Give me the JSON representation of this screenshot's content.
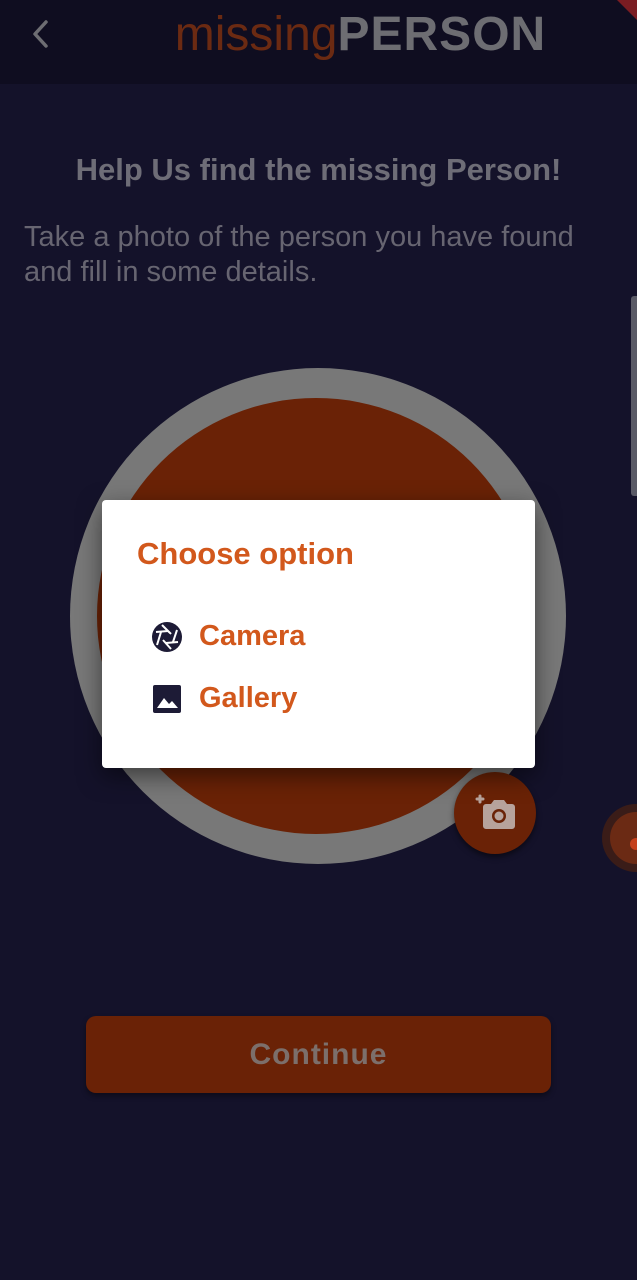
{
  "app_bar": {
    "title_part1": "missing",
    "title_part2": "PERSON",
    "back_icon": "chevron-left-icon"
  },
  "main": {
    "heading": "Help Us find the missing Person!",
    "description": "Take a photo of the person you have found and fill in some details.",
    "add_photo_icon": "add-a-photo-icon",
    "continue_label": "Continue"
  },
  "dialog": {
    "title": "Choose option",
    "options": [
      {
        "label": "Camera",
        "icon": "camera-shutter-icon"
      },
      {
        "label": "Gallery",
        "icon": "image-icon"
      }
    ]
  },
  "colors": {
    "background": "#14122a",
    "accent": "#d2581c",
    "accent_dark": "#6a2206",
    "dialog_bg": "#ffffff"
  }
}
